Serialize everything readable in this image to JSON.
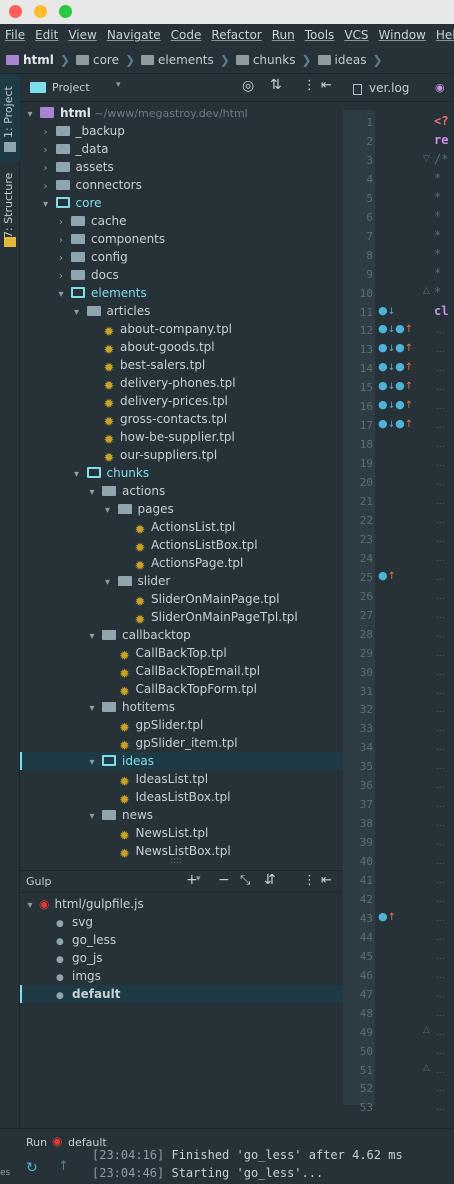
{
  "menu": [
    "File",
    "Edit",
    "View",
    "Navigate",
    "Code",
    "Refactor",
    "Run",
    "Tools",
    "VCS",
    "Window",
    "Help"
  ],
  "breadcrumbs": [
    "html",
    "core",
    "elements",
    "chunks",
    "ideas"
  ],
  "left_tabs": {
    "project": "1: Project",
    "structure": "7: Structure"
  },
  "project_panel": {
    "title": "Project"
  },
  "editor_tab": {
    "name": "ver.log"
  },
  "tree": [
    {
      "label": "html",
      "hint": "~/www/megastroy.dev/html",
      "depth": 0,
      "kind": "root",
      "open": true
    },
    {
      "label": "_backup",
      "depth": 1,
      "kind": "folder"
    },
    {
      "label": "_data",
      "depth": 1,
      "kind": "folder"
    },
    {
      "label": "assets",
      "depth": 1,
      "kind": "folder"
    },
    {
      "label": "connectors",
      "depth": 1,
      "kind": "folder"
    },
    {
      "label": "core",
      "depth": 1,
      "kind": "folder",
      "open": true
    },
    {
      "label": "cache",
      "depth": 2,
      "kind": "folder"
    },
    {
      "label": "components",
      "depth": 2,
      "kind": "folder"
    },
    {
      "label": "config",
      "depth": 2,
      "kind": "folder"
    },
    {
      "label": "docs",
      "depth": 2,
      "kind": "folder"
    },
    {
      "label": "elements",
      "depth": 2,
      "kind": "folder",
      "open": true
    },
    {
      "label": "articles",
      "depth": 3,
      "kind": "folder",
      "open": true
    },
    {
      "label": "about-company.tpl",
      "depth": 4,
      "kind": "tpl"
    },
    {
      "label": "about-goods.tpl",
      "depth": 4,
      "kind": "tpl"
    },
    {
      "label": "best-salers.tpl",
      "depth": 4,
      "kind": "tpl"
    },
    {
      "label": "delivery-phones.tpl",
      "depth": 4,
      "kind": "tpl"
    },
    {
      "label": "delivery-prices.tpl",
      "depth": 4,
      "kind": "tpl"
    },
    {
      "label": "gross-contacts.tpl",
      "depth": 4,
      "kind": "tpl"
    },
    {
      "label": "how-be-supplier.tpl",
      "depth": 4,
      "kind": "tpl"
    },
    {
      "label": "our-suppliers.tpl",
      "depth": 4,
      "kind": "tpl"
    },
    {
      "label": "chunks",
      "depth": 3,
      "kind": "folder",
      "open": true
    },
    {
      "label": "actions",
      "depth": 4,
      "kind": "folder",
      "open": true
    },
    {
      "label": "pages",
      "depth": 5,
      "kind": "folder",
      "open": true
    },
    {
      "label": "ActionsList.tpl",
      "depth": 6,
      "kind": "tpl"
    },
    {
      "label": "ActionsListBox.tpl",
      "depth": 6,
      "kind": "tpl"
    },
    {
      "label": "ActionsPage.tpl",
      "depth": 6,
      "kind": "tpl"
    },
    {
      "label": "slider",
      "depth": 5,
      "kind": "folder",
      "open": true
    },
    {
      "label": "SliderOnMainPage.tpl",
      "depth": 6,
      "kind": "tpl"
    },
    {
      "label": "SliderOnMainPageTpl.tpl",
      "depth": 6,
      "kind": "tpl"
    },
    {
      "label": "callbacktop",
      "depth": 4,
      "kind": "folder",
      "open": true
    },
    {
      "label": "CallBackTop.tpl",
      "depth": 5,
      "kind": "tpl"
    },
    {
      "label": "CallBackTopEmail.tpl",
      "depth": 5,
      "kind": "tpl"
    },
    {
      "label": "CallBackTopForm.tpl",
      "depth": 5,
      "kind": "tpl"
    },
    {
      "label": "hotitems",
      "depth": 4,
      "kind": "folder",
      "open": true
    },
    {
      "label": "gpSlider.tpl",
      "depth": 5,
      "kind": "tpl"
    },
    {
      "label": "gpSlider_item.tpl",
      "depth": 5,
      "kind": "tpl"
    },
    {
      "label": "ideas",
      "depth": 4,
      "kind": "folder",
      "open": true,
      "selected": true
    },
    {
      "label": "IdeasList.tpl",
      "depth": 5,
      "kind": "tpl"
    },
    {
      "label": "IdeasListBox.tpl",
      "depth": 5,
      "kind": "tpl"
    },
    {
      "label": "news",
      "depth": 4,
      "kind": "folder",
      "open": true
    },
    {
      "label": "NewsList.tpl",
      "depth": 5,
      "kind": "tpl"
    },
    {
      "label": "NewsListBox.tpl",
      "depth": 5,
      "kind": "tpl"
    }
  ],
  "gulp": {
    "title": "Gulp",
    "file": "html/gulpfile.js",
    "tasks": [
      "svg",
      "go_less",
      "go_js",
      "imgs",
      "default"
    ],
    "selected_task": "default"
  },
  "editor": {
    "line_numbers": [
      1,
      2,
      3,
      4,
      5,
      6,
      7,
      8,
      9,
      10,
      11,
      12,
      13,
      14,
      15,
      16,
      17,
      18,
      19,
      20,
      21,
      22,
      23,
      24,
      25,
      26,
      27,
      28,
      29,
      30,
      31,
      32,
      33,
      34,
      35,
      36,
      37,
      38,
      39,
      40,
      41,
      42,
      43,
      44,
      45,
      46,
      47,
      48,
      49,
      50,
      51,
      52,
      53
    ],
    "code_fragments": [
      {
        "line": 1,
        "text": "<?",
        "color": "#f07178"
      },
      {
        "line": 2,
        "text": "re",
        "color": "#c792ea"
      },
      {
        "line": 3,
        "text": "/*",
        "color": "#546e7a"
      },
      {
        "line": 4,
        "text": " *",
        "color": "#546e7a"
      },
      {
        "line": 5,
        "text": " *",
        "color": "#546e7a"
      },
      {
        "line": 6,
        "text": " *",
        "color": "#546e7a"
      },
      {
        "line": 7,
        "text": " *",
        "color": "#546e7a"
      },
      {
        "line": 8,
        "text": " *",
        "color": "#546e7a"
      },
      {
        "line": 9,
        "text": " *",
        "color": "#546e7a"
      },
      {
        "line": 10,
        "text": " *",
        "color": "#546e7a"
      },
      {
        "line": 11,
        "text": "cl",
        "color": "#c792ea"
      }
    ]
  },
  "run": {
    "label": "Run",
    "config": "default"
  },
  "console": [
    {
      "time": "[23:04:16]",
      "text": "Finished 'go_less' after 4.62 ms"
    },
    {
      "time": "[23:04:46]",
      "text": "Starting 'go_less'..."
    }
  ],
  "colors": {
    "accent": "#80deea",
    "folder": "#90a4ae",
    "tpl": "#c9a227",
    "selection": "#1e3a44"
  }
}
